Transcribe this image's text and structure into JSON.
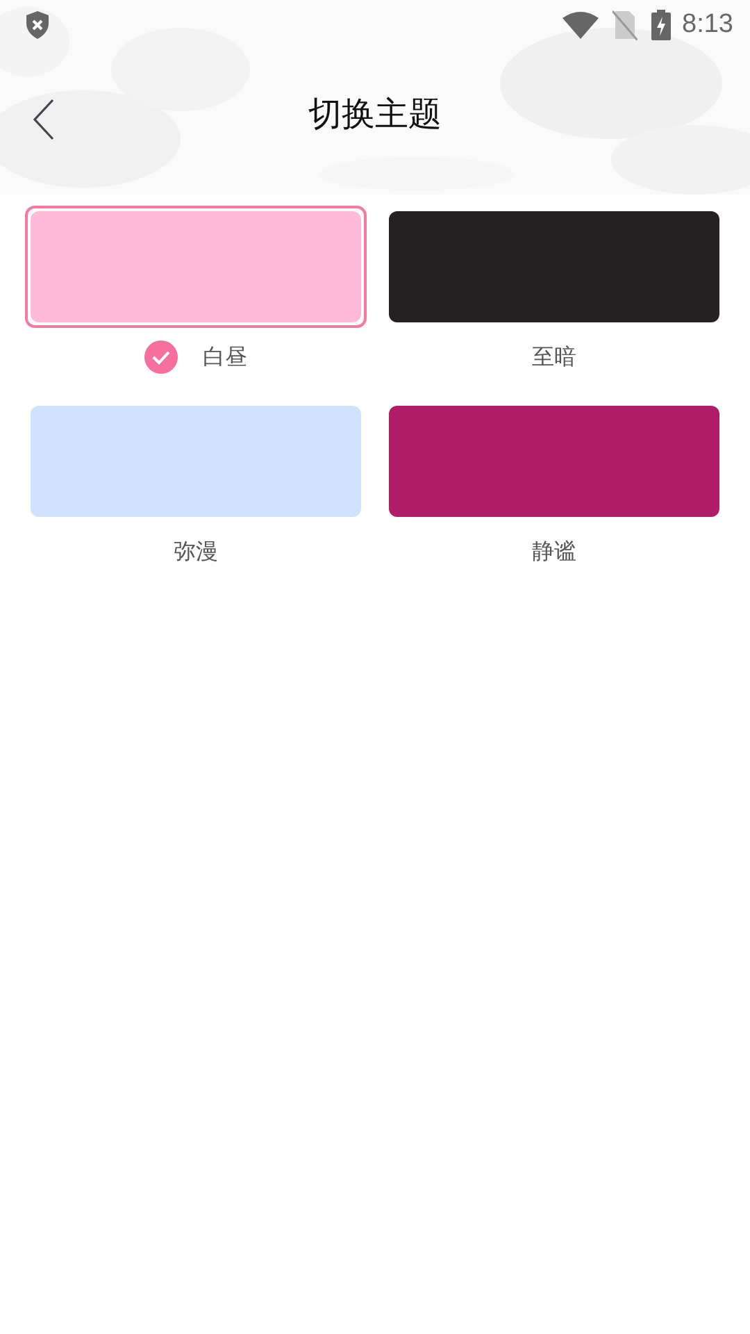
{
  "status_bar": {
    "time": "8:13"
  },
  "header": {
    "title": "切换主题"
  },
  "themes": [
    {
      "name": "白昼",
      "color": "#ffbbd7",
      "selected": true
    },
    {
      "name": "至暗",
      "color": "#252021",
      "selected": false
    },
    {
      "name": "弥漫",
      "color": "#cfe3fe",
      "selected": false
    },
    {
      "name": "静谧",
      "color": "#b01c68",
      "selected": false
    }
  ]
}
